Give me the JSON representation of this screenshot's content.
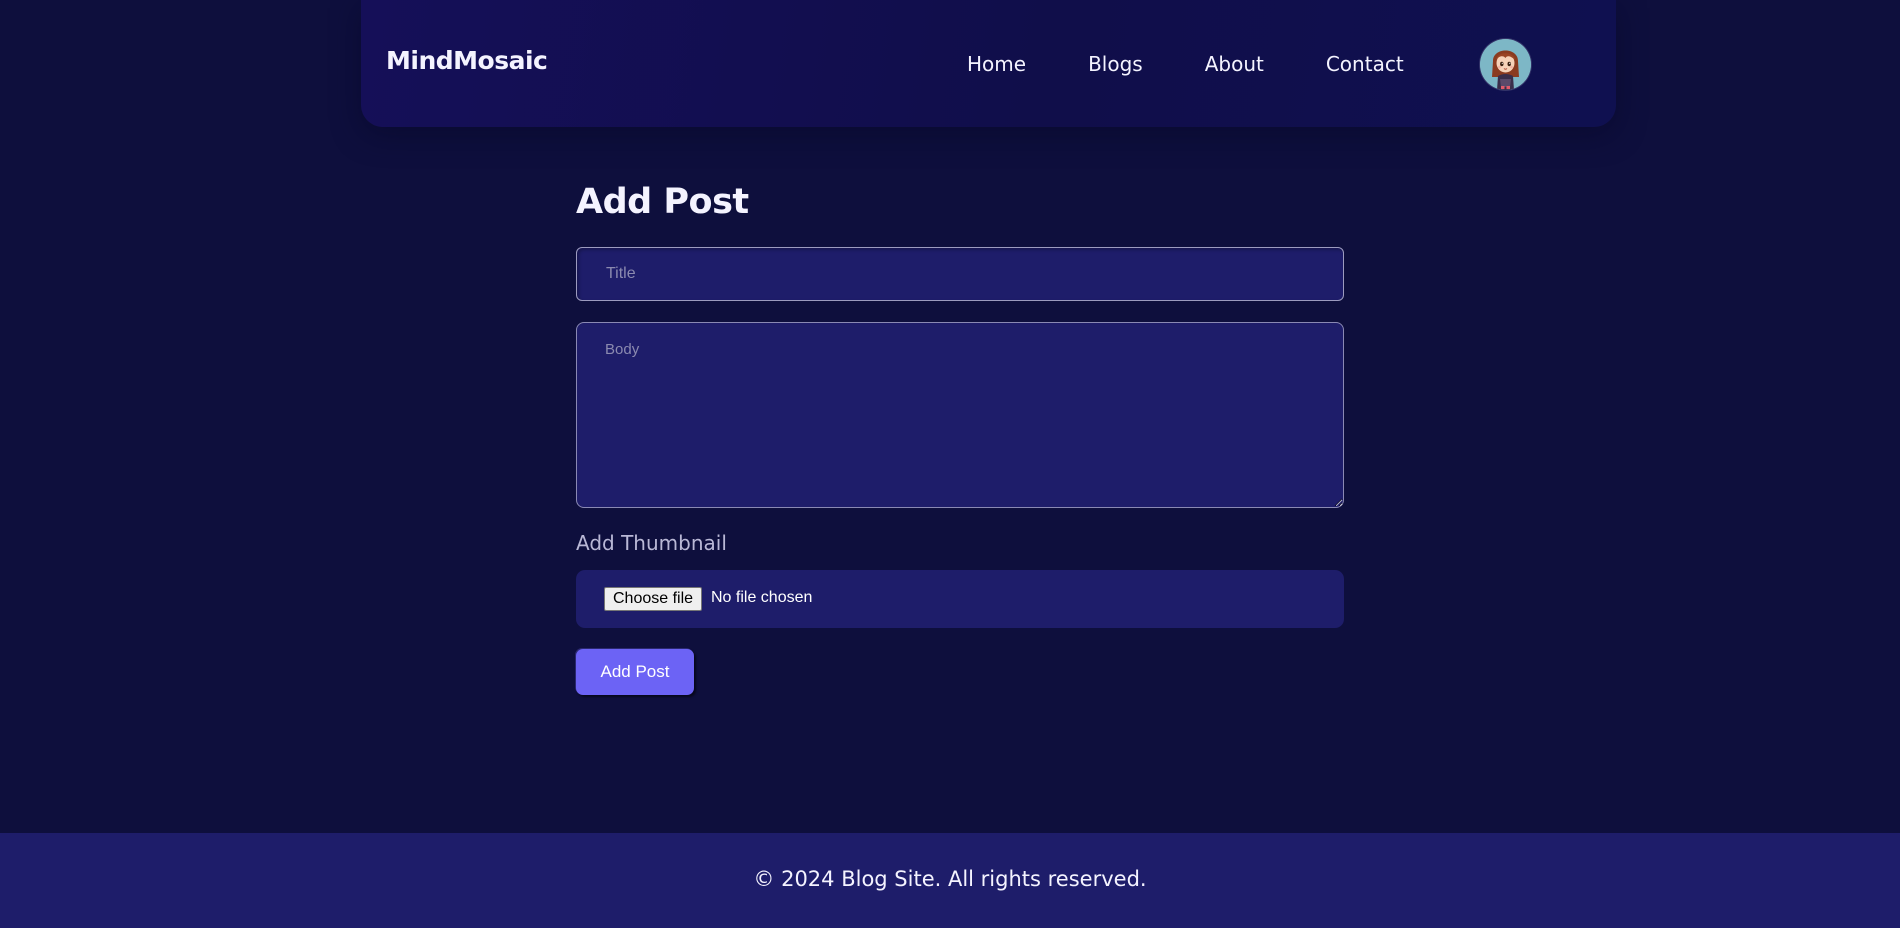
{
  "navbar": {
    "brand": "MindMosaic",
    "links": [
      {
        "label": "Home"
      },
      {
        "label": "Blogs"
      },
      {
        "label": "About"
      },
      {
        "label": "Contact"
      }
    ]
  },
  "main": {
    "title": "Add Post",
    "title_input": {
      "placeholder": "Title",
      "value": ""
    },
    "body_input": {
      "placeholder": "Body",
      "value": ""
    },
    "thumbnail_label": "Add Thumbnail",
    "file_input": {
      "button_label": "Choose file",
      "status": "No file chosen"
    },
    "submit_label": "Add Post"
  },
  "footer": {
    "text": "© 2024 Blog Site. All rights reserved."
  },
  "colors": {
    "page_background": "#0e0f3d",
    "navbar_background": "#130f55",
    "field_background": "#1e1d6a",
    "accent": "#6c63f5",
    "footer_background": "#1e1d6a"
  },
  "icons": {
    "avatar": "user-avatar-girl-illustration"
  }
}
